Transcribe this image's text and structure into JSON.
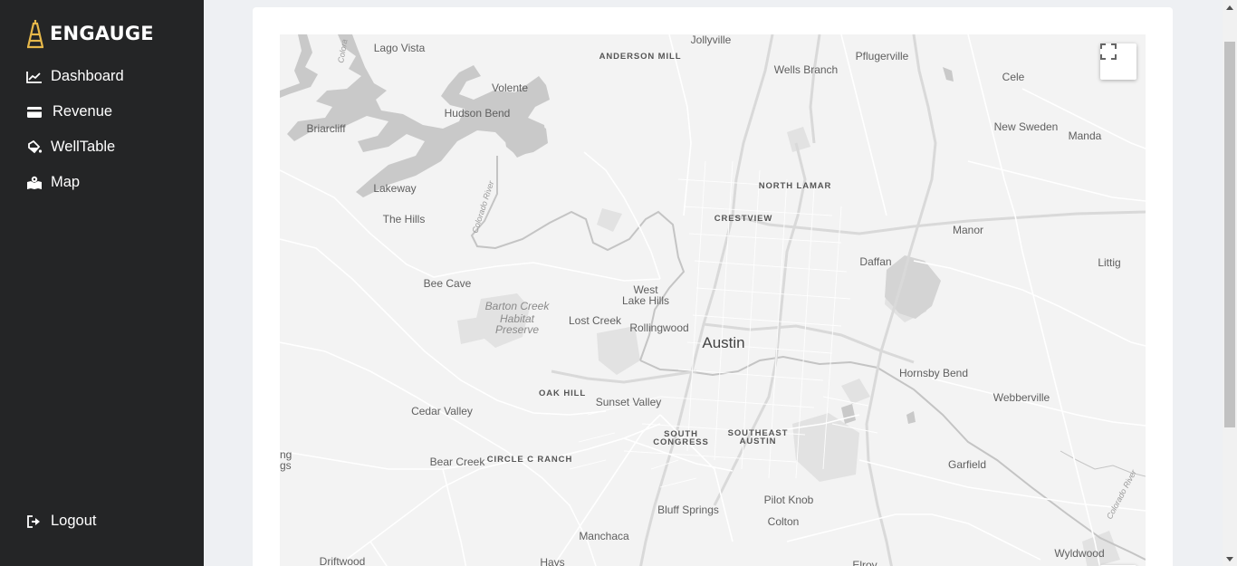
{
  "brand": {
    "name": "ENGAUGE",
    "accent": "#e7b84a"
  },
  "nav": {
    "dashboard": "Dashboard",
    "revenue": "Revenue",
    "welltable": "WellTable",
    "map": "Map",
    "logout": "Logout"
  },
  "map": {
    "labels": {
      "jollyville": "Jollyville",
      "lago_vista": "Lago Vista",
      "anderson_mill": "ANDERSON MILL",
      "wells_branch": "Wells Branch",
      "pflugerville": "Pflugerville",
      "cele": "Cele",
      "volente": "Volente",
      "hudson_bend": "Hudson Bend",
      "briarcliff": "Briarcliff",
      "new_sweden": "New Sweden",
      "manda": "Manda",
      "lakeway": "Lakeway",
      "north_lamar": "NORTH LAMAR",
      "the_hills": "The Hills",
      "crestview": "CRESTVIEW",
      "manor": "Manor",
      "daffan": "Daffan",
      "littig": "Littig",
      "bee_cave": "Bee Cave",
      "west_lake_hills_1": "West",
      "west_lake_hills_2": "Lake Hills",
      "barton_1": "Barton Creek",
      "barton_2": "Habitat",
      "barton_3": "Preserve",
      "lost_creek": "Lost Creek",
      "rollingwood": "Rollingwood",
      "austin": "Austin",
      "hornsby_bend": "Hornsby Bend",
      "oak_hill": "OAK HILL",
      "webberville": "Webberville",
      "sunset_valley": "Sunset Valley",
      "cedar_valley": "Cedar Valley",
      "south_congress_1": "SOUTH",
      "south_congress_2": "CONGRESS",
      "southeast_austin_1": "SOUTHEAST",
      "southeast_austin_2": "AUSTIN",
      "edge_left_1": "ng",
      "edge_left_2": "gs",
      "bear_creek": "Bear Creek",
      "circle_c_ranch": "CIRCLE C RANCH",
      "garfield": "Garfield",
      "pilot_knob": "Pilot Knob",
      "bluff_springs": "Bluff Springs",
      "colton": "Colton",
      "manchaca": "Manchaca",
      "wyldwood": "Wyldwood",
      "driftwood": "Driftwood",
      "hays": "Hays",
      "elroy": "Elroy",
      "colorado_river_nw": "Colorado River",
      "colorado_river_e": "Colorado River",
      "colorado_top": "Colora"
    },
    "controls": {
      "fullscreen_icon": "fullscreen-icon"
    },
    "colors": {
      "land": "#f3f3f3",
      "water": "#c8c8c8",
      "road": "#ffffff",
      "park": "#dedede"
    }
  }
}
